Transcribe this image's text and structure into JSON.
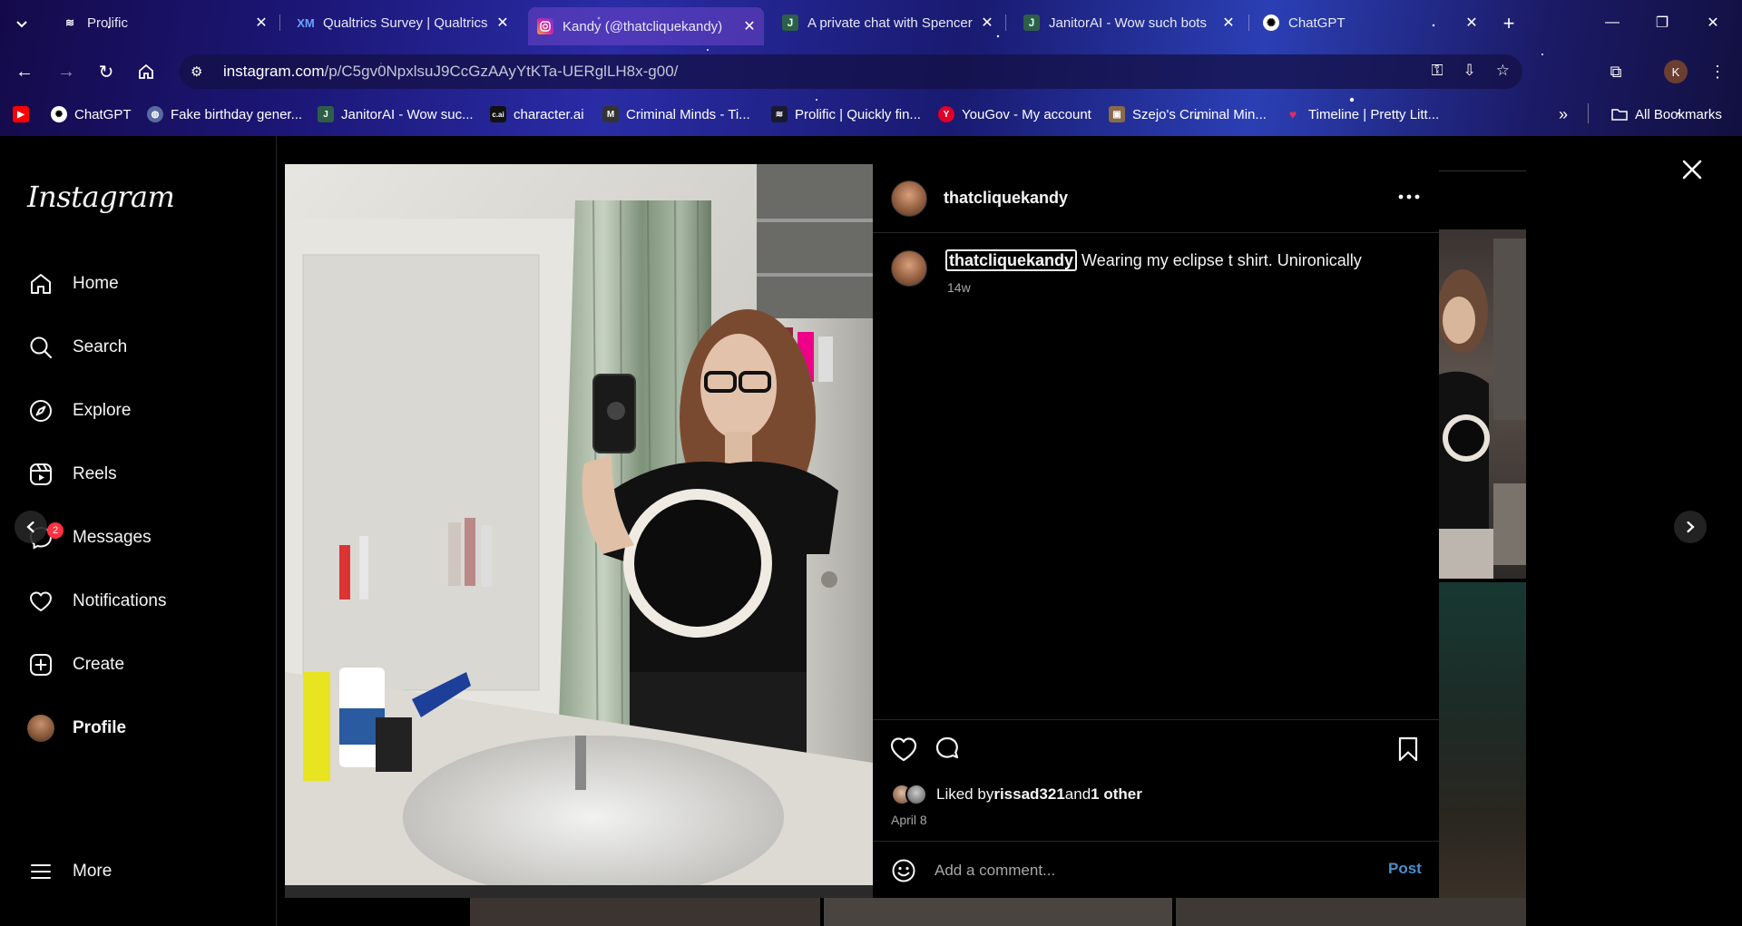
{
  "browser": {
    "tabs": [
      {
        "title": "Prolific",
        "icon": "prolific-icon",
        "color": "#1a1a2e"
      },
      {
        "title": "Qualtrics Survey | Qualtrics",
        "icon": "qualtrics-icon",
        "color": "#2b5ea8"
      },
      {
        "title": "Kandy (@thatcliquekandy)",
        "icon": "instagram-icon",
        "color": "#d6249f"
      },
      {
        "title": "A private chat with Spencer",
        "icon": "janitorai-icon",
        "color": "#3a7a5a"
      },
      {
        "title": "JanitorAI - Wow such bots",
        "icon": "janitorai-icon",
        "color": "#3a7a5a"
      },
      {
        "title": "ChatGPT",
        "icon": "chatgpt-icon",
        "color": "#ffffff"
      }
    ],
    "url_host": "instagram.com",
    "url_path": "/p/C5gv0NpxlsuJ9CcGzAAyYtKTa-UERglLH8x-g00/",
    "profile_initial": "K",
    "bookmarks": [
      {
        "label": "",
        "icon": "youtube-icon",
        "color": "#ff0000"
      },
      {
        "label": "ChatGPT",
        "icon": "chatgpt-icon",
        "color": "#ffffff"
      },
      {
        "label": "Fake birthday gener...",
        "icon": "globe-icon",
        "color": "#8aa0d0"
      },
      {
        "label": "JanitorAI - Wow suc...",
        "icon": "janitorai-icon",
        "color": "#3a7a5a"
      },
      {
        "label": "character.ai",
        "icon": "characterai-icon",
        "color": "#111111"
      },
      {
        "label": "Criminal Minds - Ti...",
        "icon": "criminalminds-icon",
        "color": "#444444"
      },
      {
        "label": "Prolific | Quickly fin...",
        "icon": "prolific-icon",
        "color": "#1a1a2e"
      },
      {
        "label": "YouGov - My account",
        "icon": "yougov-icon",
        "color": "#e0002a"
      },
      {
        "label": "Szejo's Criminal Min...",
        "icon": "image-icon",
        "color": "#8a6a4a"
      },
      {
        "label": "Timeline | Pretty Litt...",
        "icon": "heart-icon",
        "color": "#cc2255"
      }
    ],
    "all_bookmarks": "All Bookmarks"
  },
  "sidebar": {
    "logo": "Instagram",
    "items": [
      {
        "label": "Home",
        "icon": "home-icon"
      },
      {
        "label": "Search",
        "icon": "search-icon"
      },
      {
        "label": "Explore",
        "icon": "compass-icon"
      },
      {
        "label": "Reels",
        "icon": "reels-icon"
      },
      {
        "label": "Messages",
        "icon": "messenger-icon",
        "badge": "2"
      },
      {
        "label": "Notifications",
        "icon": "heart-icon"
      },
      {
        "label": "Create",
        "icon": "plus-square-icon"
      },
      {
        "label": "Profile",
        "icon": "avatar"
      }
    ],
    "more": "More"
  },
  "post": {
    "username": "thatcliquekandy",
    "caption_user": "thatcliquekandy",
    "caption_text": " Wearing my eclipse t shirt. Unironically",
    "time_ago": "14w",
    "liked_prefix": "Liked by ",
    "liked_user": "rissad321",
    "liked_and": " and ",
    "liked_other": "1 other",
    "date": "April 8",
    "comment_placeholder": "Add a comment...",
    "post_label": "Post"
  }
}
